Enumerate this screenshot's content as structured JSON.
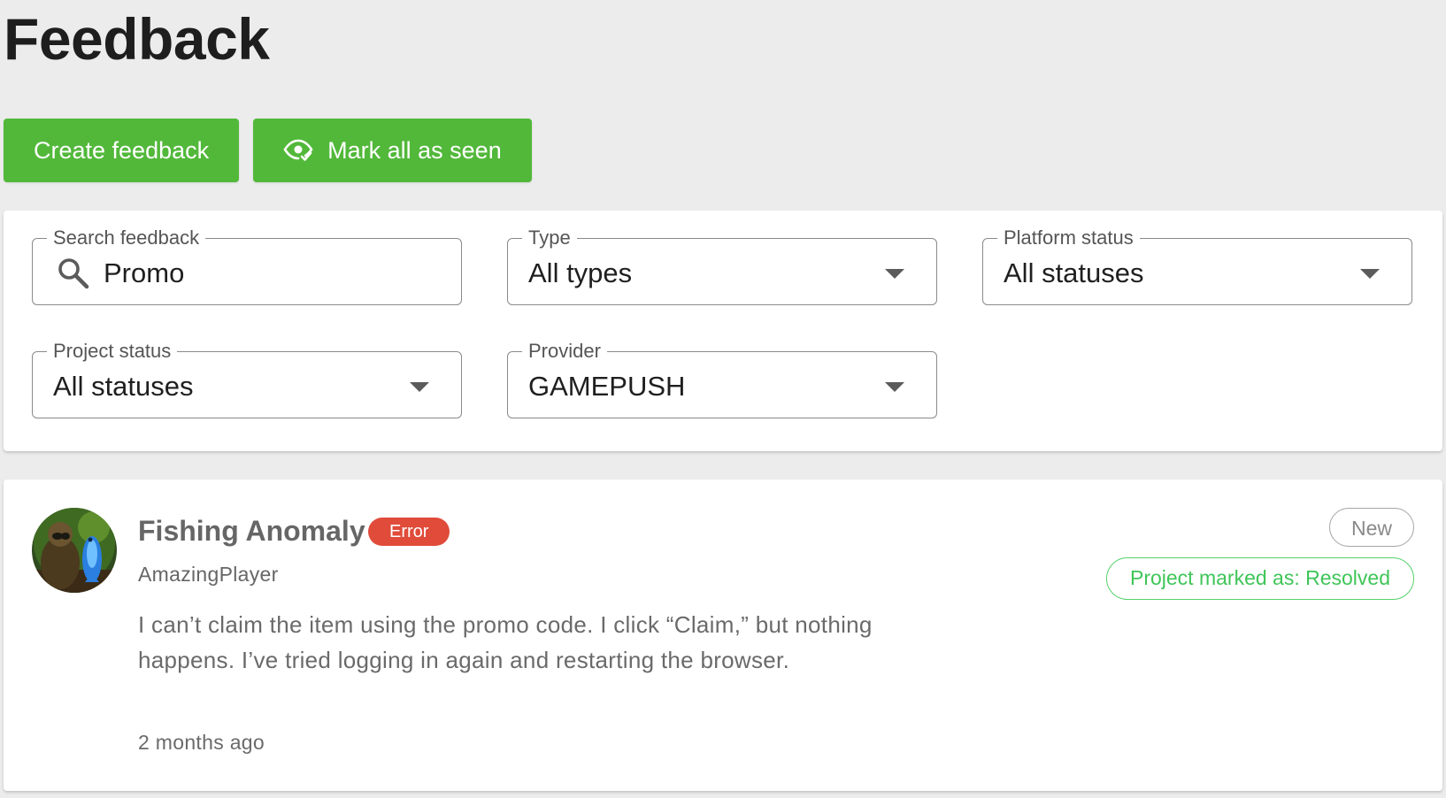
{
  "page": {
    "title": "Feedback"
  },
  "actions": {
    "create_label": "Create feedback",
    "mark_seen_label": "Mark all as seen",
    "mark_seen_icon": "eye-check-icon"
  },
  "filters": {
    "search": {
      "label": "Search feedback",
      "value": "Promo",
      "icon": "search-icon"
    },
    "type": {
      "label": "Type",
      "value": "All types"
    },
    "platform_status": {
      "label": "Platform status",
      "value": "All statuses"
    },
    "project_status": {
      "label": "Project status",
      "value": "All statuses"
    },
    "provider": {
      "label": "Provider",
      "value": "GAMEPUSH"
    }
  },
  "feedback_items": [
    {
      "title": "Fishing Anomaly",
      "type_badge": "Error",
      "author": "AmazingPlayer",
      "message": "I can’t claim the item using the promo code. I click “Claim,” but nothing happens. I’ve tried logging in again and restarting the browser.",
      "time": "2 months ago",
      "status_new": "New",
      "project_status": "Project marked as: Resolved"
    }
  ],
  "colors": {
    "accent_green": "#52b83a",
    "error_red": "#e04b3a",
    "resolved_green": "#3fc558",
    "background": "#ececec"
  }
}
